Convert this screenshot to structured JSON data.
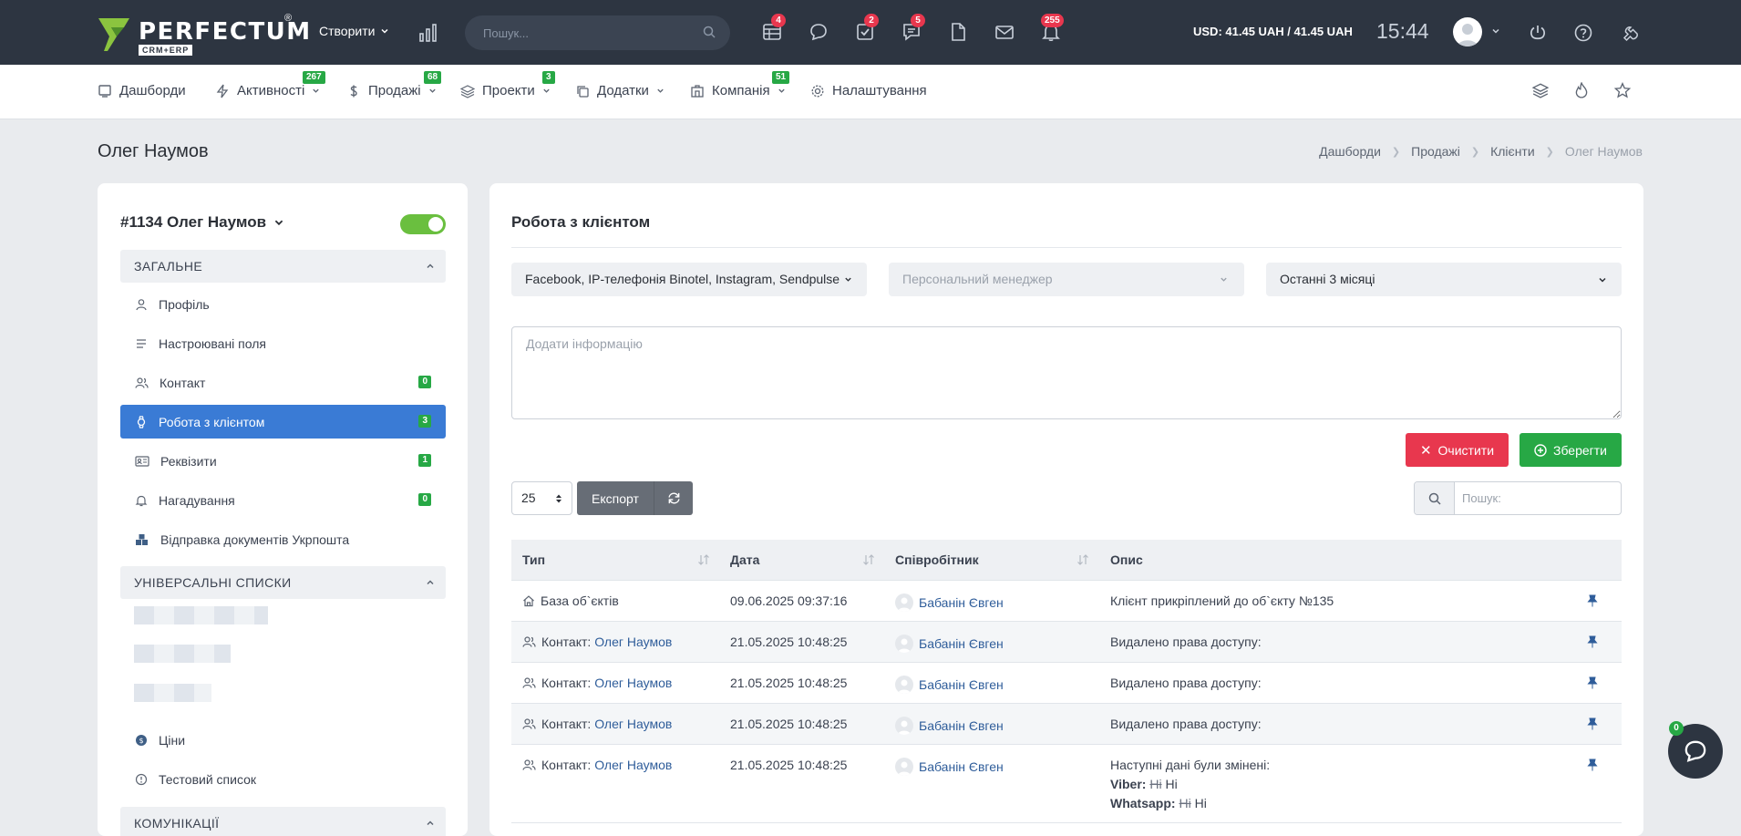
{
  "topbar": {
    "logo_text": "PERFECTUM",
    "logo_reg": "®",
    "logo_sub": "CRM+ERP",
    "create_label": "Створити",
    "search_placeholder": "Пошук...",
    "badges": {
      "tasks_board": "4",
      "checklist": "2",
      "comments": "5",
      "notifications": "255"
    },
    "currency": "USD: 41.45 UAH / 41.45 UAH",
    "time": "15:44"
  },
  "nav": {
    "items": [
      {
        "label": "Дашборди",
        "badge": ""
      },
      {
        "label": "Активності",
        "badge": "267"
      },
      {
        "label": "Продажі",
        "badge": "68"
      },
      {
        "label": "Проекти",
        "badge": "3"
      },
      {
        "label": "Додатки",
        "badge": ""
      },
      {
        "label": "Компанія",
        "badge": "51"
      },
      {
        "label": "Налаштування",
        "badge": ""
      }
    ]
  },
  "page": {
    "title": "Олег Наумов",
    "breadcrumb": [
      "Дашборди",
      "Продажі",
      "Клієнти",
      "Олег Наумов"
    ]
  },
  "sidebar": {
    "client": "#1134 Олег Наумов",
    "section_general": "ЗАГАЛЬНЕ",
    "items": [
      {
        "label": "Профіль",
        "badge": ""
      },
      {
        "label": "Настроювані поля",
        "badge": ""
      },
      {
        "label": "Контакт",
        "badge": "0"
      },
      {
        "label": "Робота з клієнтом",
        "badge": "3"
      },
      {
        "label": "Реквізити",
        "badge": "1"
      },
      {
        "label": "Нагадування",
        "badge": "0"
      },
      {
        "label": "Відправка документів Укрпошта",
        "badge": ""
      }
    ],
    "section_universal": "УНІВЕРСАЛЬНІ СПИСКИ",
    "universal_items": [
      {
        "label": "Ціни"
      },
      {
        "label": "Тестовий список"
      }
    ],
    "section_comm": "КОМУНІКАЦІЇ"
  },
  "main": {
    "title": "Робота з клієнтом",
    "filter_channels": "Facebook, IP-телефонія Binotel, Instagram, Sendpulse",
    "filter_manager": "Персональний менеджер",
    "filter_period": "Останні 3 місяці",
    "info_placeholder": "Додати інформацію",
    "clear_label": "Очистити",
    "save_label": "Зберегти",
    "page_size": "25",
    "export_label": "Експорт",
    "search_placeholder": "Пошук:",
    "columns": [
      "Тип",
      "Дата",
      "Співробітник",
      "Опис"
    ],
    "rows": [
      {
        "type": "База об`єктів",
        "type_link": "",
        "date": "09.06.2025 09:37:16",
        "employee": "Бабанін Євген",
        "desc": "Клієнт прикріплений до об`єкту №135"
      },
      {
        "type": "Контакт: ",
        "type_link": "Олег Наумов",
        "date": "21.05.2025 10:48:25",
        "employee": "Бабанін Євген",
        "desc": "Видалено права доступу:"
      },
      {
        "type": "Контакт: ",
        "type_link": "Олег Наумов",
        "date": "21.05.2025 10:48:25",
        "employee": "Бабанін Євген",
        "desc": "Видалено права доступу:"
      },
      {
        "type": "Контакт: ",
        "type_link": "Олег Наумов",
        "date": "21.05.2025 10:48:25",
        "employee": "Бабанін Євген",
        "desc": "Видалено права доступу:"
      },
      {
        "type": "Контакт: ",
        "type_link": "Олег Наумов",
        "date": "21.05.2025 10:48:25",
        "employee": "Бабанін Євген",
        "desc": "Наступні дані були змінені:"
      }
    ],
    "changes": [
      {
        "field": "Viber",
        "old": "Hi",
        "new": "Hi"
      },
      {
        "field": "Whatsapp",
        "old": "Hi",
        "new": "Hi"
      }
    ]
  },
  "chat": {
    "badge": "0"
  }
}
